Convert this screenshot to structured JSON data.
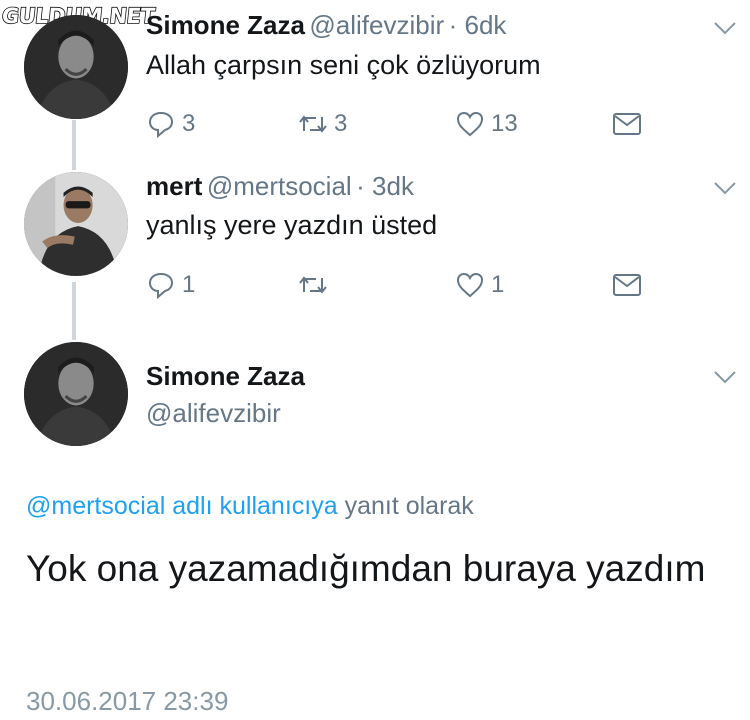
{
  "watermark": "GULDUM.NET",
  "tweets": [
    {
      "name": "Simone Zaza",
      "handle": "@alifevzibir",
      "time": "· 6dk",
      "text": "Allah çarpsın seni çok özlüyorum",
      "replies": "3",
      "retweets": "3",
      "likes": "13"
    },
    {
      "name": "mert",
      "handle": "@mertsocial",
      "time": "· 3dk",
      "text": "yanlış yere yazdın üsted",
      "replies": "1",
      "retweets": "",
      "likes": "1"
    }
  ],
  "main_tweet": {
    "name": "Simone Zaza",
    "handle": "@alifevzibir",
    "reply_to_link": "@mertsocial adlı kullanıcıya",
    "reply_to_suffix": "yanıt olarak",
    "text": "Yok ona yazamadığımdan buraya yazdım",
    "timestamp": "30.06.2017 23:39"
  },
  "colors": {
    "link": "#1da1f2",
    "muted": "#657786",
    "timestamp": "#8899a6",
    "thread_line": "#cfd6dc"
  },
  "icons": [
    "reply-icon",
    "retweet-icon",
    "like-icon",
    "dm-icon",
    "chevron-down-icon"
  ]
}
